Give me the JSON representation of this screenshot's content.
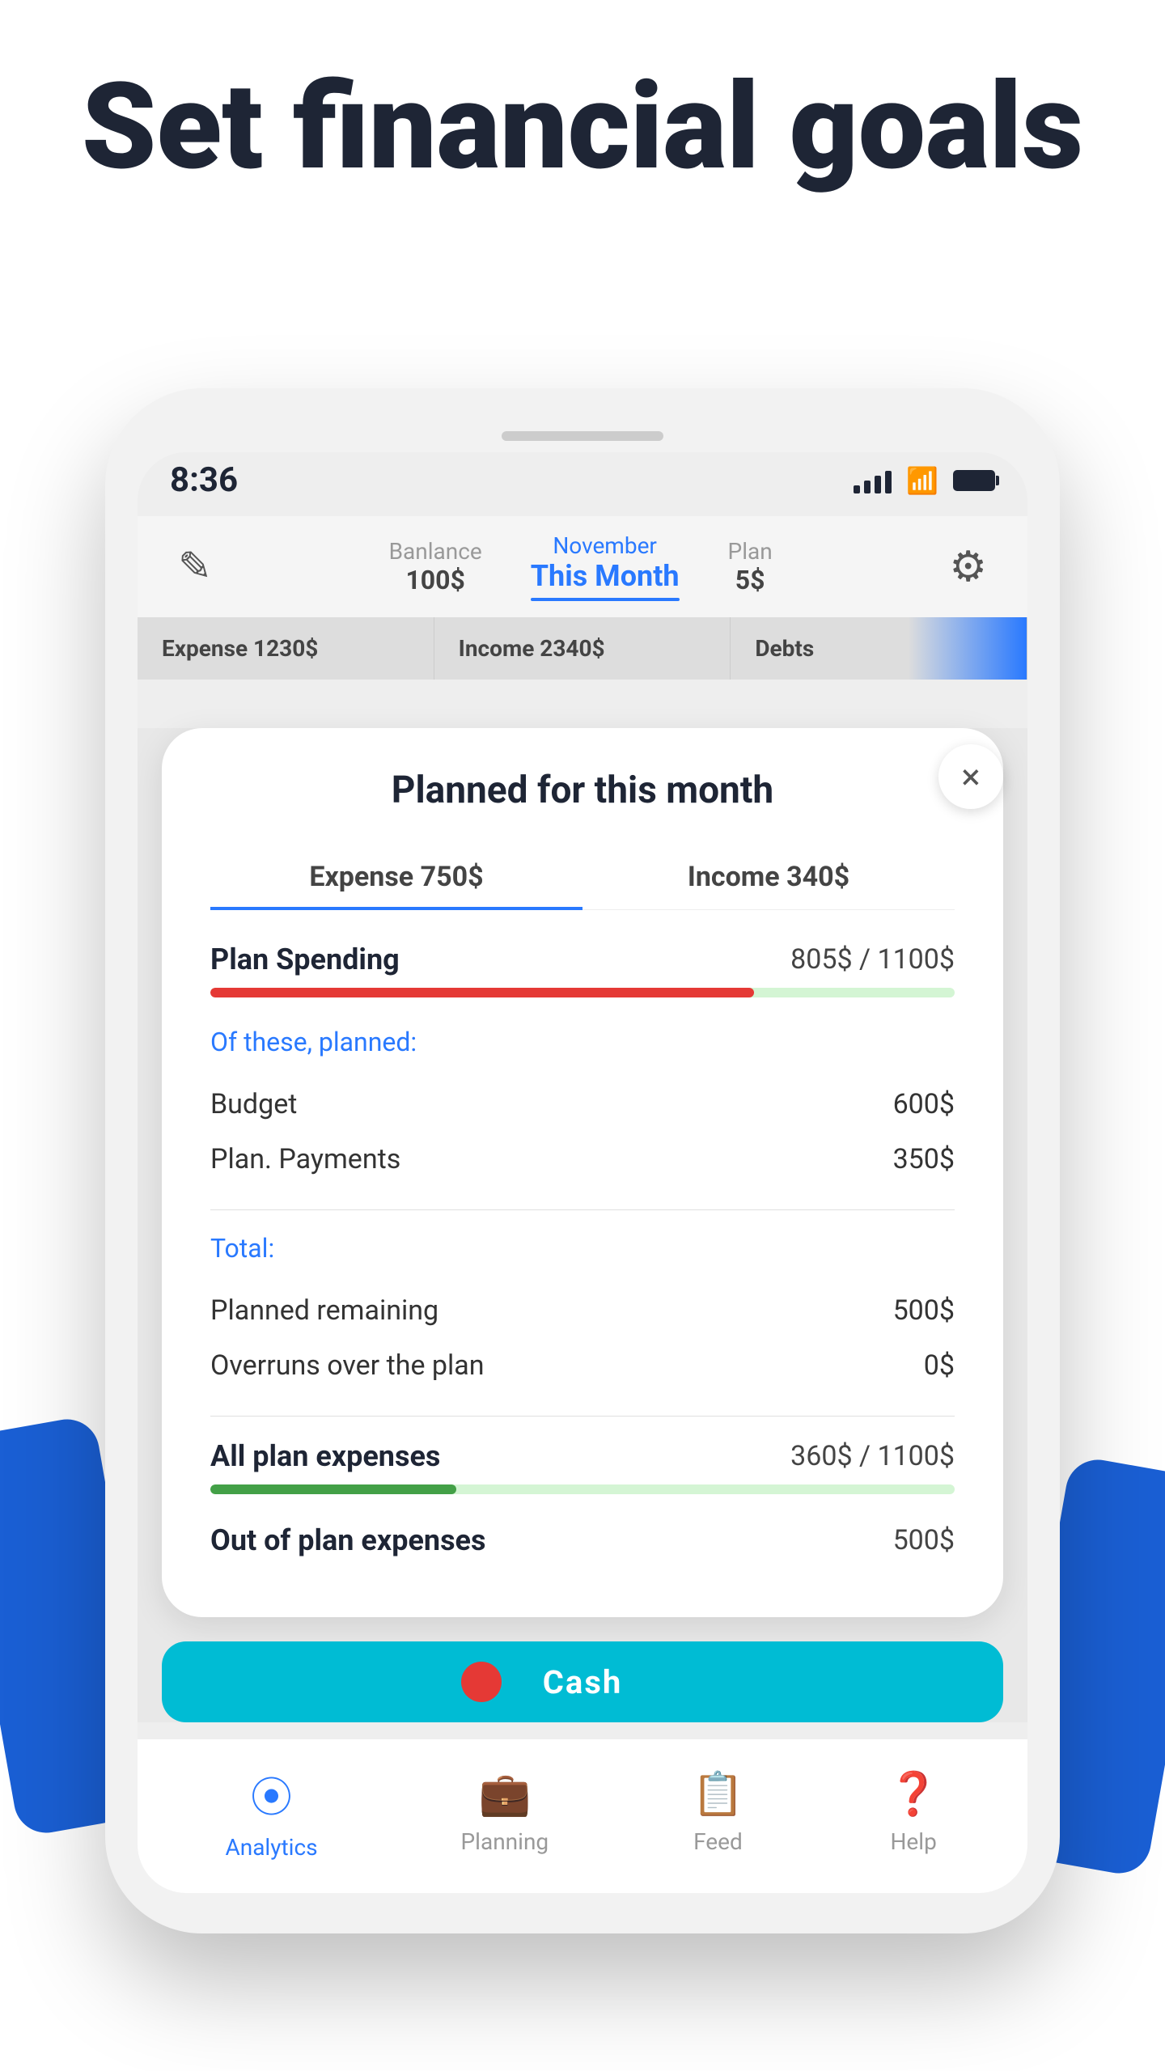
{
  "hero": {
    "title": "Set financial goals"
  },
  "status_bar": {
    "time": "8:36"
  },
  "top_nav": {
    "balance_label": "Banlance",
    "balance_value": "100$",
    "month_label": "November",
    "month_sublabel": "This Month",
    "plan_label": "Plan",
    "plan_value": "5$"
  },
  "summary_strip": {
    "expense_label": "Expense",
    "expense_value": "1230$",
    "income_label": "Income",
    "income_value": "2340$",
    "debts_label": "Debts"
  },
  "modal": {
    "title": "Planned for this month",
    "tab_expense_label": "Expense",
    "tab_expense_value": "750$",
    "tab_income_label": "Income",
    "tab_income_value": "340$",
    "plan_spending_label": "Plan Spending",
    "plan_spending_value": "805$ / 1100$",
    "plan_spending_progress": 73,
    "of_these_planned_label": "Of these, planned:",
    "budget_label": "Budget",
    "budget_value": "600$",
    "plan_payments_label": "Plan. Payments",
    "plan_payments_value": "350$",
    "total_label": "Total:",
    "planned_remaining_label": "Planned remaining",
    "planned_remaining_value": "500$",
    "overruns_label": "Overruns over the plan",
    "overruns_value": "0$",
    "all_plan_expenses_label": "All plan expenses",
    "all_plan_expenses_value": "360$ / 1100$",
    "all_plan_expenses_progress": 33,
    "out_of_plan_label": "Out of plan expenses",
    "out_of_plan_value": "500$",
    "close_button": "×"
  },
  "cash_bar": {
    "text": "Cash"
  },
  "bottom_nav": {
    "analytics_label": "Analytics",
    "planning_label": "Planning",
    "feed_label": "Feed",
    "help_label": "Help"
  }
}
